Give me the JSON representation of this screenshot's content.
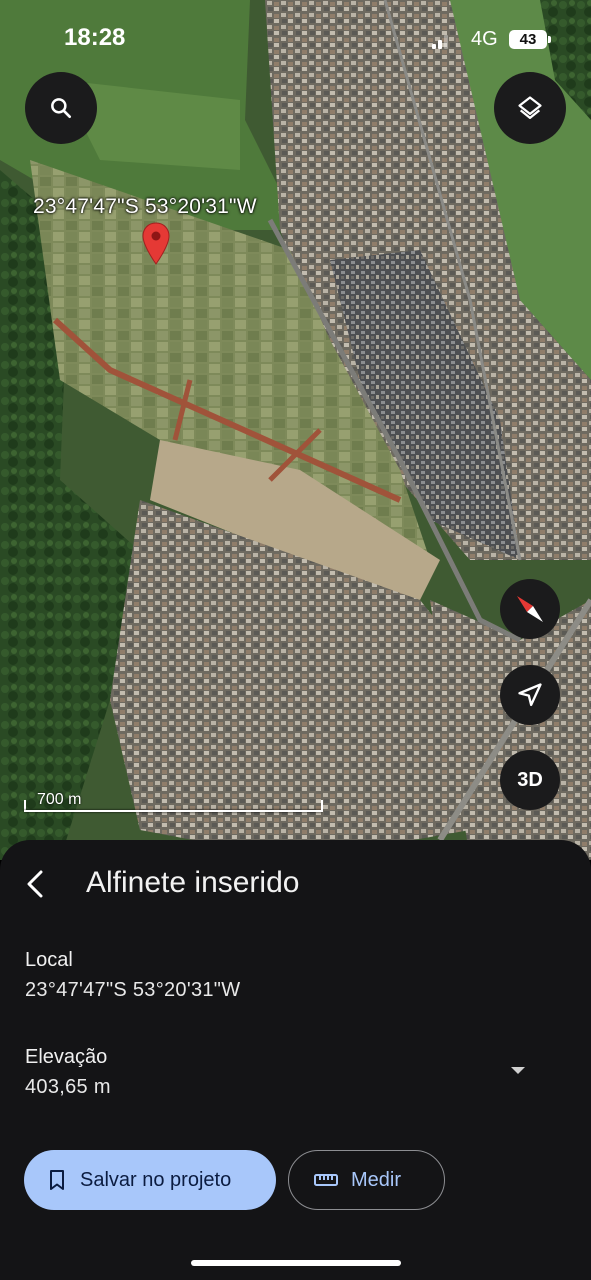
{
  "status_bar": {
    "time": "18:28",
    "network": "4G",
    "battery": "43"
  },
  "map": {
    "pin_coordinates_label": "23°47'47\"S 53°20'31\"W",
    "scale_label": "700 m",
    "compass_colors": {
      "north": "#e53935",
      "south": "#ffffff"
    }
  },
  "controls": {
    "search_icon": "search-icon",
    "layers_icon": "layers-icon",
    "compass_icon": "compass-icon",
    "location_icon": "navigation-arrow-icon",
    "three_d_label": "3D"
  },
  "sheet": {
    "title": "Alfinete inserido",
    "local_label": "Local",
    "local_value": "23°47'47\"S 53°20'31\"W",
    "elevation_label": "Elevação",
    "elevation_value": "403,65 m",
    "save_button_label": "Salvar no projeto",
    "measure_button_label": "Medir"
  },
  "colors": {
    "accent": "#a8c7fa",
    "sheet_bg": "#141416",
    "pin": "#e53935"
  }
}
